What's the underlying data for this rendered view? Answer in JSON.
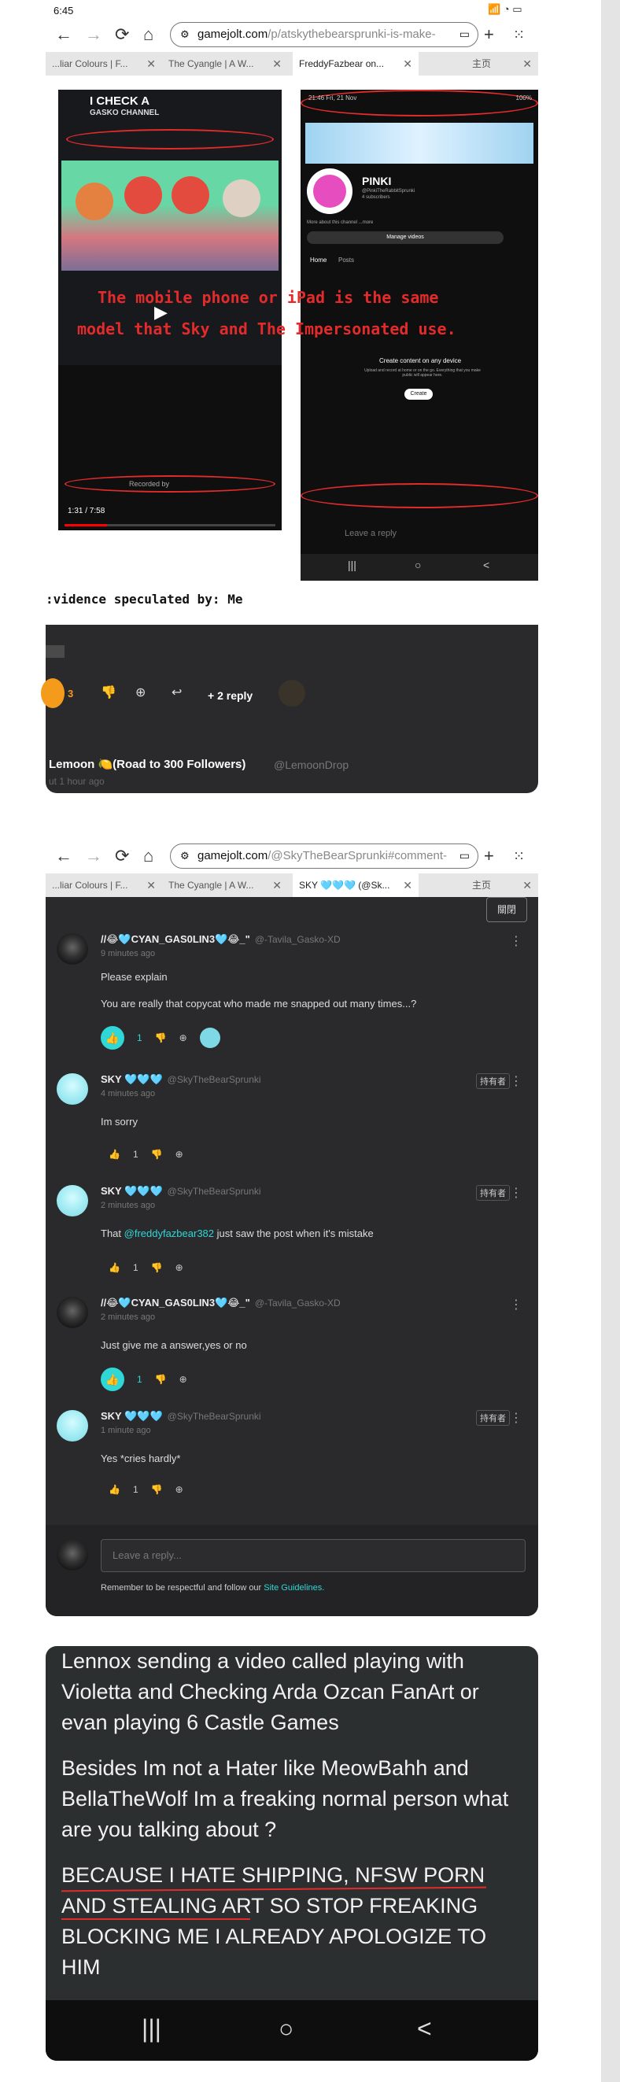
{
  "status_bar": {
    "time": "6:45",
    "icons": "📶 ◉"
  },
  "browser1": {
    "url_domain": "gamejolt.com",
    "url_path": "/p/atskythebearsprunki-is-make-",
    "tabs": [
      {
        "label": "...liar Colours | F..."
      },
      {
        "label": "The Cyangle | A W..."
      },
      {
        "label": "FreddyFazbear on..."
      },
      {
        "label": "主页"
      }
    ]
  },
  "screenshot": {
    "left_channel_title": "I CHECK A",
    "left_channel_name": "GASKO CHANNEL",
    "left_video_time": "1:31 / 7:58",
    "left_recorded": "Recorded by",
    "right_status": "21:46  Fri, 21 Nov",
    "right_battery": "100%",
    "right_profile_name": "PINKI",
    "right_profile_handle": "@PinkiTheRabbitSprunki",
    "right_subscribers": "4 subscribers",
    "right_more": "More about this channel ...more",
    "right_manage": "Manage videos",
    "right_tab_home": "Home",
    "right_tab_posts": "Posts",
    "right_create_title": "Create content on any device",
    "right_create_sub": "Upload and record at home or on the go. Everything that you make public will appear here.",
    "right_create_btn": "Create",
    "right_reply": "Leave a reply",
    "overlay_line1": "The mobile phone or iPad is the same",
    "overlay_line2": "model that Sky and The Impersonated use."
  },
  "evidence_caption": ":vidence speculated by: Me",
  "snippet": {
    "like_count": "3",
    "reply_label": "+ 2 reply",
    "author": "Lemoon 🍋(Road to 300 Followers)",
    "author_handle": "@LemoonDrop",
    "time": "ut 1 hour ago"
  },
  "browser2": {
    "url_domain": "gamejolt.com",
    "url_path": "/@SkyTheBearSprunki#comment-",
    "tabs": [
      {
        "label": "...liar Colours | F..."
      },
      {
        "label": "The Cyangle | A W..."
      },
      {
        "label": "SKY 🩵🩵🩵 (@Sk..."
      },
      {
        "label": "主页"
      }
    ],
    "close_button": "關閉"
  },
  "comments": [
    {
      "name": "//😂🩵CYAN_GAS0LIN3🩵😂_\"",
      "handle": "@-Tavila_Gasko-XD",
      "time": "9 minutes ago",
      "lines": [
        "Please explain",
        "You are really that copycat who made me snapped out many times...?"
      ],
      "likes": "1",
      "tag": ""
    },
    {
      "name": "SKY 🩵🩵🩵",
      "handle": "@SkyTheBearSprunki",
      "time": "4 minutes ago",
      "lines": [
        "Im sorry"
      ],
      "likes": "1",
      "tag": "持有者"
    },
    {
      "name": "SKY 🩵🩵🩵",
      "handle": "@SkyTheBearSprunki",
      "time": "2 minutes ago",
      "lines": [
        "That",
        "@freddyfazbear382",
        "just saw the post when it's mistake"
      ],
      "likes": "1",
      "tag": "持有者"
    },
    {
      "name": "//😂🩵CYAN_GAS0LIN3🩵😂_\"",
      "handle": "@-Tavila_Gasko-XD",
      "time": "2 minutes ago",
      "lines": [
        "Just give me a answer,yes or no"
      ],
      "likes": "1",
      "tag": ""
    },
    {
      "name": "SKY 🩵🩵🩵",
      "handle": "@SkyTheBearSprunki",
      "time": "1 minute ago",
      "lines": [
        "Yes *cries hardly*"
      ],
      "likes": "1",
      "tag": "持有者"
    }
  ],
  "reply_box": {
    "placeholder": "Leave a reply...",
    "guideline_prefix": "Remember to be respectful and follow our",
    "guideline_link": "Site Guidelines."
  },
  "phone_text": {
    "para1": "Lennox sending a video called playing with Violetta and Checking Arda Ozcan FanArt or evan playing 6 Castle Games",
    "para2": "Besides Im not a Hater like MeowBahh and BellaTheWolf Im a freaking normal person what are you talking about ?",
    "para3": "BECAUSE I HATE SHIPPING, NFSW PORN AND STEALING ART SO STOP FREAKING BLOCKING ME I ALREADY APOLOGIZE TO HIM"
  },
  "colors": {
    "accent": "#2fd7d7",
    "orange": "#f49b1c",
    "annotation_red": "#e42b2b",
    "card_bg": "#2a2a2c"
  }
}
